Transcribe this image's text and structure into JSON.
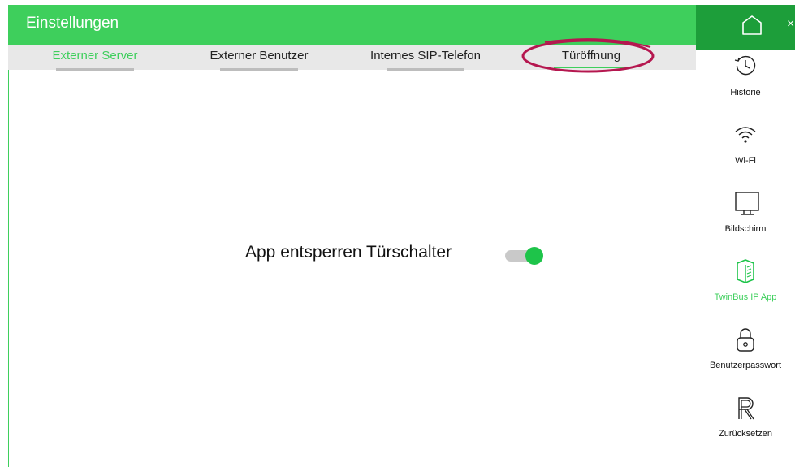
{
  "header": {
    "title": "Einstellungen"
  },
  "tabs": [
    {
      "label": "Externer Server"
    },
    {
      "label": "Externer Benutzer"
    },
    {
      "label": "Internes SIP-Telefon"
    },
    {
      "label": "Türöffnung"
    }
  ],
  "main": {
    "setting_label": "App entsperren Türschalter",
    "toggle_on": true
  },
  "sidebar": {
    "close_glyph": "×",
    "items": [
      {
        "label": "Historie",
        "icon": "history-icon"
      },
      {
        "label": "Wi-Fi",
        "icon": "wifi-icon"
      },
      {
        "label": "Bildschirm",
        "icon": "monitor-icon"
      },
      {
        "label": "TwinBus IP App",
        "icon": "app-book-icon"
      },
      {
        "label": "Benutzerpasswort",
        "icon": "lock-icon"
      },
      {
        "label": "Zurücksetzen",
        "icon": "reset-icon"
      }
    ]
  },
  "colors": {
    "header_green": "#3ecf5c",
    "home_green": "#1d9e3a",
    "highlight_ellipse": "#b5174f",
    "toggle_knob": "#1ec44a"
  }
}
